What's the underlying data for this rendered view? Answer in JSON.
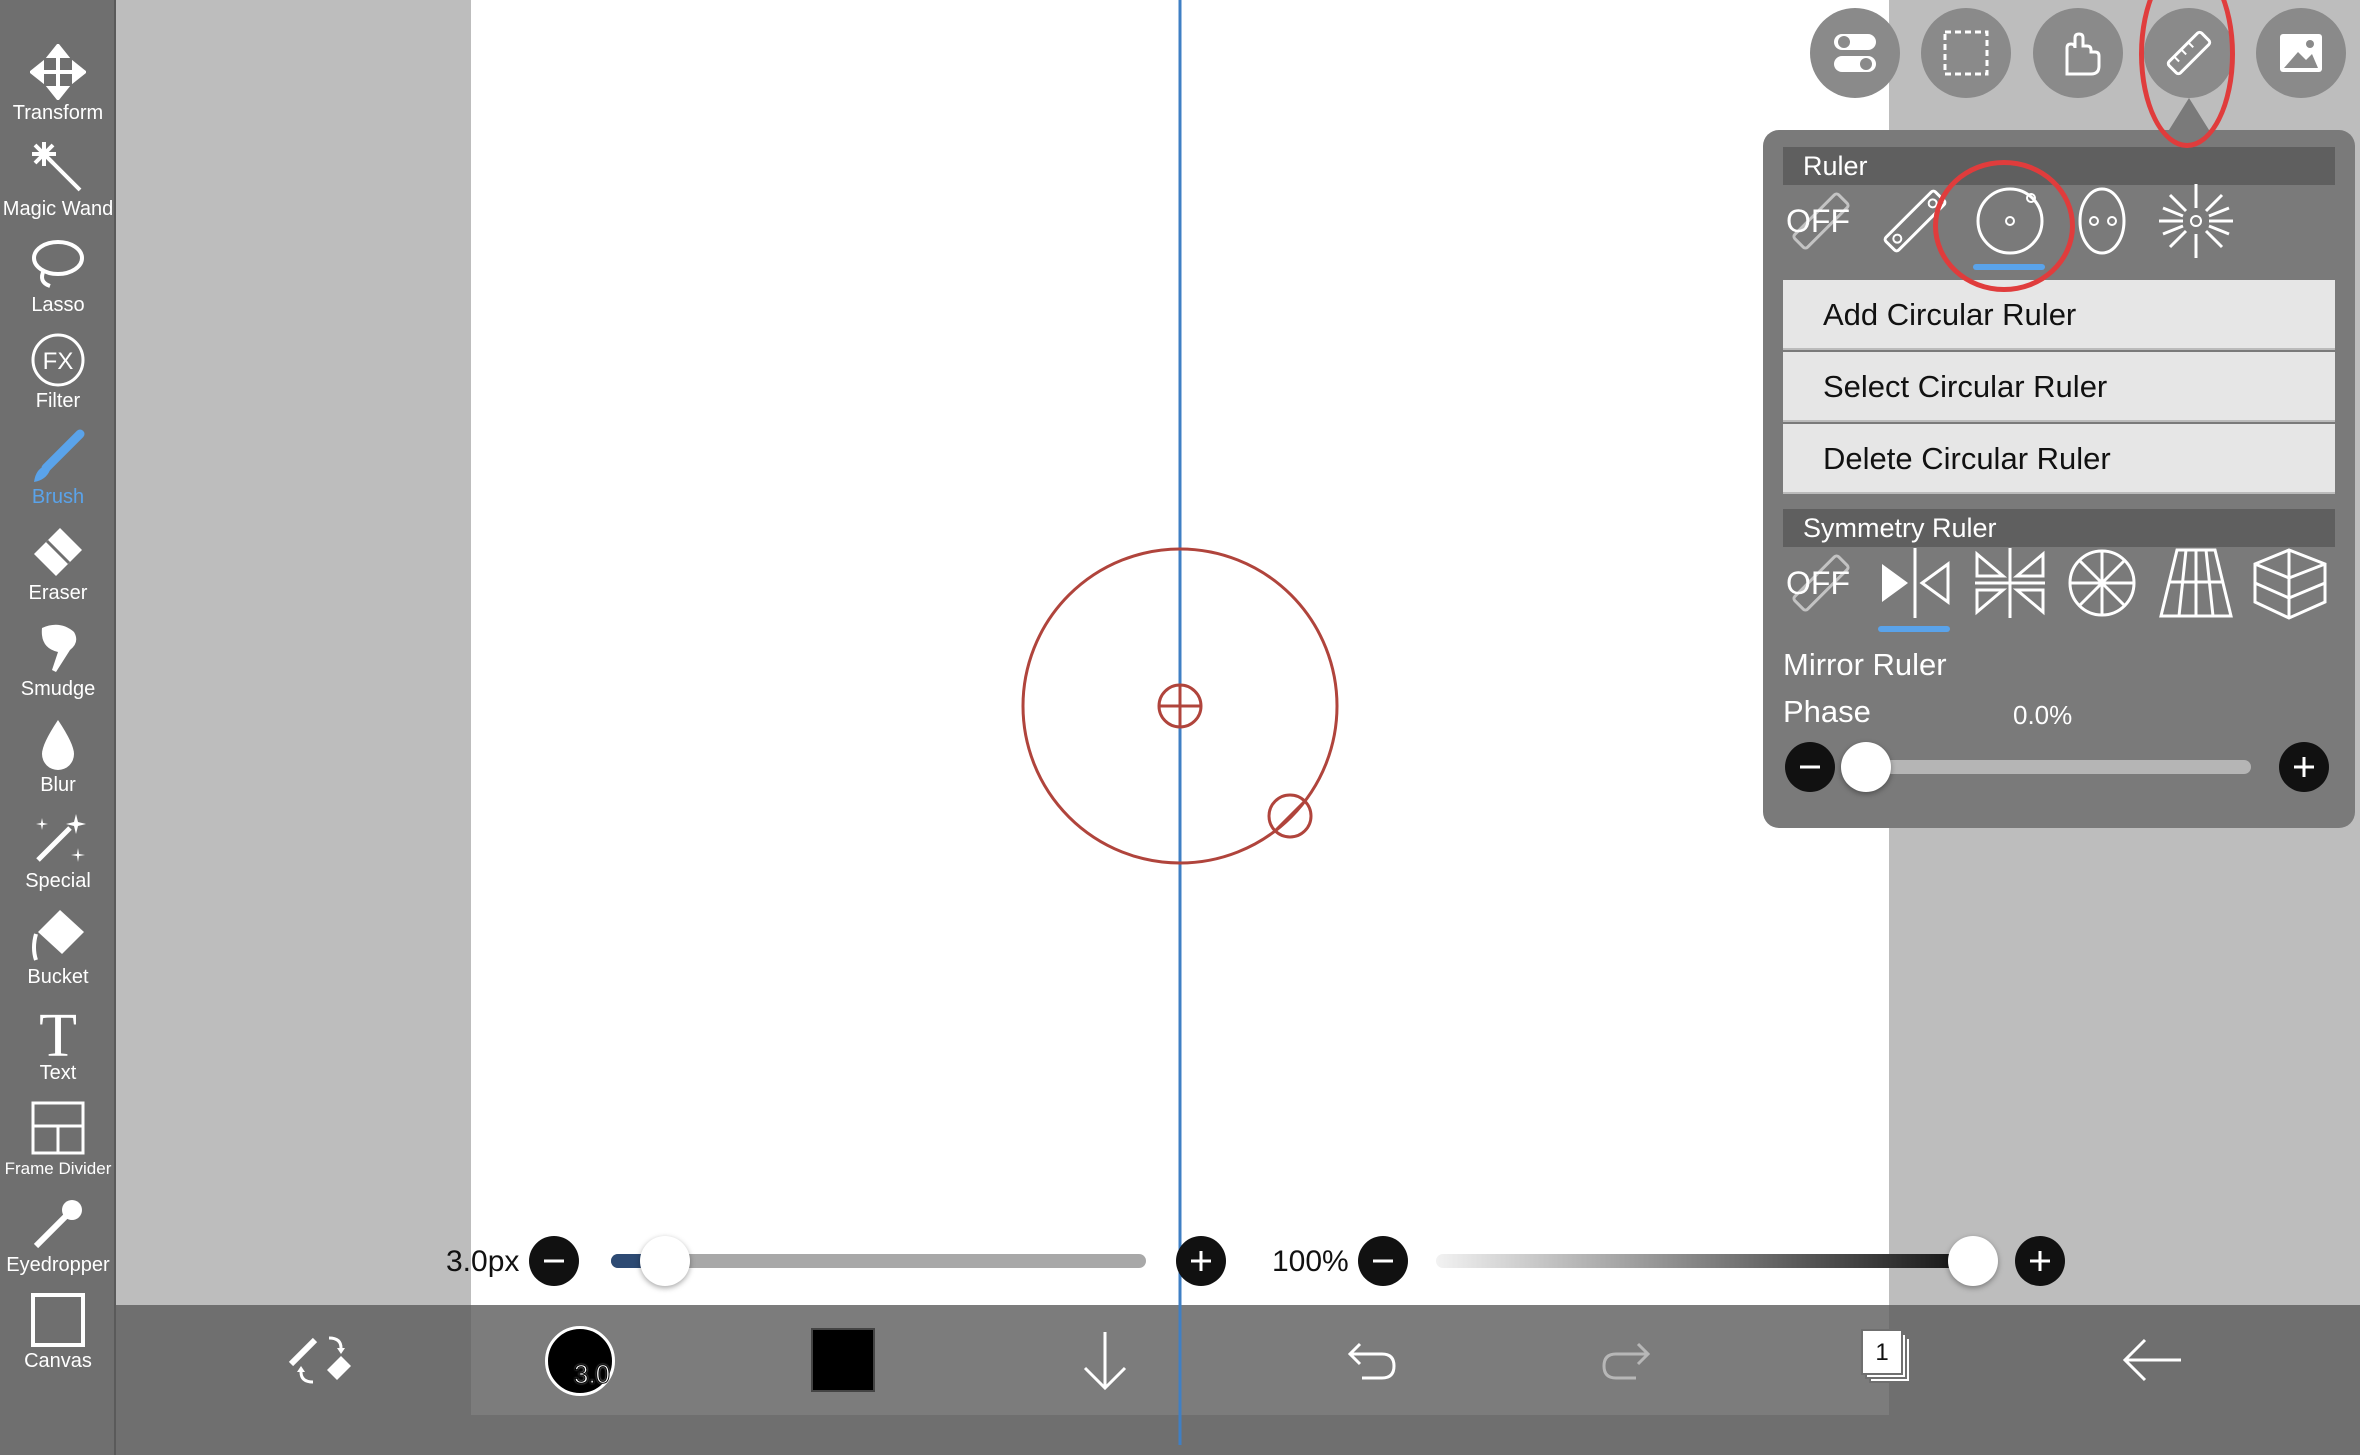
{
  "toolbar": {
    "tools": [
      {
        "label": "Transform"
      },
      {
        "label": "Magic Wand"
      },
      {
        "label": "Lasso"
      },
      {
        "label": "Filter"
      },
      {
        "label": "Brush"
      },
      {
        "label": "Eraser"
      },
      {
        "label": "Smudge"
      },
      {
        "label": "Blur"
      },
      {
        "label": "Special"
      },
      {
        "label": "Bucket"
      },
      {
        "label": "Text"
      },
      {
        "label": "Frame Divider"
      },
      {
        "label": "Eyedropper"
      },
      {
        "label": "Canvas"
      }
    ],
    "active_tool": "Brush",
    "filter_icon_text": "FX",
    "text_icon_text": "T"
  },
  "top_buttons": [
    "toggle-icon",
    "selection-icon",
    "hand-icon",
    "ruler-icon",
    "image-icon"
  ],
  "ruler_panel": {
    "ruler_header": "Ruler",
    "off_label": "OFF",
    "ruler_options": [
      "off",
      "straight-ruler",
      "circular-ruler",
      "ellipse-ruler",
      "radial-ruler"
    ],
    "selected_ruler": "circular-ruler",
    "menu": [
      "Add Circular Ruler",
      "Select Circular Ruler",
      "Delete Circular Ruler"
    ],
    "symmetry_header": "Symmetry Ruler",
    "symmetry_off_label": "OFF",
    "symmetry_options": [
      "off",
      "mirror",
      "kaleidoscope",
      "rotation",
      "perspective",
      "3d-grid"
    ],
    "selected_symmetry": "mirror",
    "mode_label": "Mirror Ruler",
    "phase_label": "Phase",
    "phase_value": "0.0%",
    "phase_fraction": 0.0
  },
  "brush_size": {
    "label": "3.0px",
    "fraction": 0.1
  },
  "opacity": {
    "label": "100%",
    "fraction": 1.0
  },
  "bottom_bar": {
    "brush_preview_text": "3.0",
    "color": "#000000",
    "layer_count": "1"
  },
  "colors": {
    "accent": "#5aa3ea",
    "ruler_guide": "#b0443c",
    "annotation": "#e03c3c",
    "symmetry_line": "#3f7fc4"
  }
}
